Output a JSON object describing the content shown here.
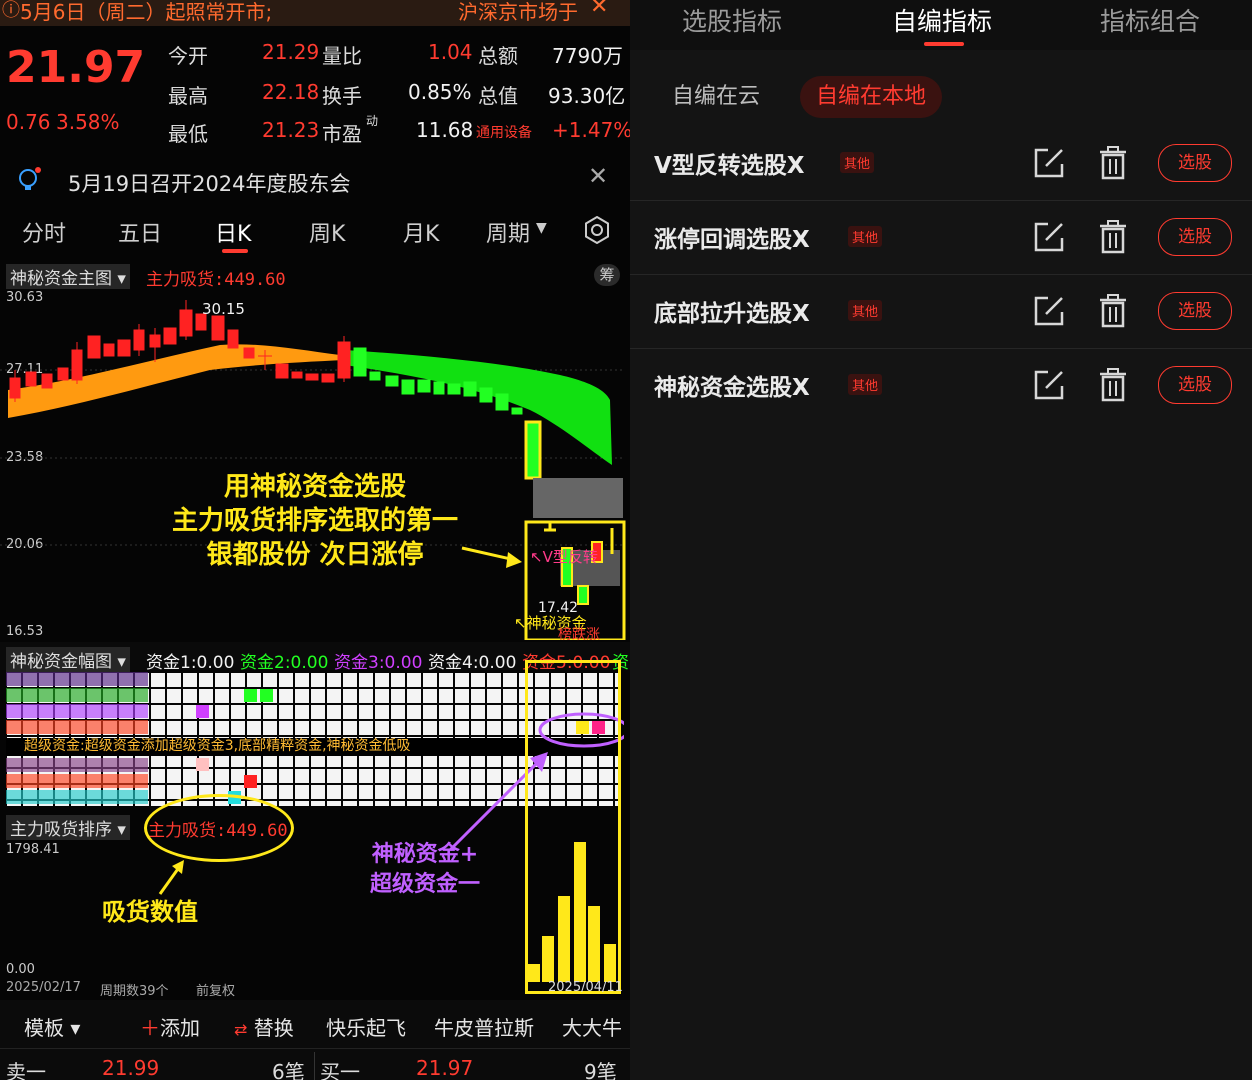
{
  "notice": {
    "text": "5月6日（周二）起照常开市;",
    "market": "沪深京市场于"
  },
  "quote": {
    "price": "21.97",
    "change": "0.76",
    "change_pct": "3.58%",
    "rows": [
      {
        "l1": "今开",
        "v1": "21.29",
        "l2": "量比",
        "v2": "1.04",
        "l3": "总额",
        "v3": "7790万"
      },
      {
        "l1": "最高",
        "v1": "22.18",
        "l2": "换手",
        "v2": "0.85%",
        "l3": "总值",
        "v3": "93.30亿"
      },
      {
        "l1": "最低",
        "v1": "21.23",
        "l2": "市盈",
        "l2sup": "动",
        "v2": "11.68",
        "l3": "通用设备",
        "v3": "+1.47%"
      }
    ]
  },
  "announcement": "5月19日召开2024年度股东会",
  "period_tabs": [
    "分时",
    "五日",
    "日K",
    "周K",
    "月K",
    "周期"
  ],
  "active_period": "日K",
  "indicator1": {
    "name": "神秘资金主图",
    "value": "主力吸货:449.60",
    "chip": "筹"
  },
  "price_axis": [
    "30.63",
    "27.11",
    "23.58",
    "20.06",
    "16.53"
  ],
  "peak_label": "30.15",
  "low_label": "17.42",
  "annotation_main": [
    "用神秘资金选股",
    "主力吸货排序选取的第一",
    "银都股份 次日涨停"
  ],
  "signal_labels": {
    "v_reverse": "V型反转",
    "mystery": "神秘资金",
    "rank": "榜跌涨"
  },
  "indicator2": {
    "name": "神秘资金幅图",
    "funds": [
      {
        "label": "资金1:0.00",
        "color": "#f2f2f2"
      },
      {
        "label": "资金2:0.00",
        "color": "#22ff22"
      },
      {
        "label": "资金3:0.00",
        "color": "#d040ff"
      },
      {
        "label": "资金4:0.00",
        "color": "#f2f2f2"
      },
      {
        "label": "资金5:0.00",
        "color": "#ff3b30"
      }
    ],
    "overflow": "资"
  },
  "grid_text": "超级资金:超级资金添加超级资金3,底部精粹资金,神秘资金低吸",
  "indicator3": {
    "name": "主力吸货排序",
    "value": "主力吸货:449.60",
    "axis_top": "1798.41",
    "axis_bottom": "0.00"
  },
  "annotation_absorb": "吸货数值",
  "annotation_super": [
    "神秘资金+",
    "超级资金一"
  ],
  "footer_info": {
    "start_date": "2025/02/17",
    "periods": "周期数39个",
    "adjust": "前复权",
    "end_date": "2025/04/11"
  },
  "toolbar": {
    "template": "模板",
    "add": "添加",
    "replace": "替换",
    "items": [
      "快乐起飞",
      "牛皮普拉斯",
      "大大牛"
    ]
  },
  "orderbook": {
    "sell_label": "卖一",
    "sell_price": "21.99",
    "sell_count": "6笔",
    "buy_label": "买一",
    "buy_price": "21.97",
    "buy_count": "9笔"
  },
  "right_tabs": [
    "选股指标",
    "自编指标",
    "指标组合"
  ],
  "right_active_tab": "自编指标",
  "sub_tabs": [
    "自编在云",
    "自编在本地"
  ],
  "sub_active": "自编在本地",
  "formulas": [
    {
      "name": "V型反转选股X",
      "tag": "其他",
      "action": "选股"
    },
    {
      "name": "涨停回调选股X",
      "tag": "其他",
      "action": "选股"
    },
    {
      "name": "底部拉升选股X",
      "tag": "其他",
      "action": "选股"
    },
    {
      "name": "神秘资金选股X",
      "tag": "其他",
      "action": "选股"
    }
  ],
  "colors": {
    "up": "#ff3b30",
    "down": "#22ff22",
    "accent_yellow": "#ffe81a",
    "purple": "#c060ff"
  }
}
